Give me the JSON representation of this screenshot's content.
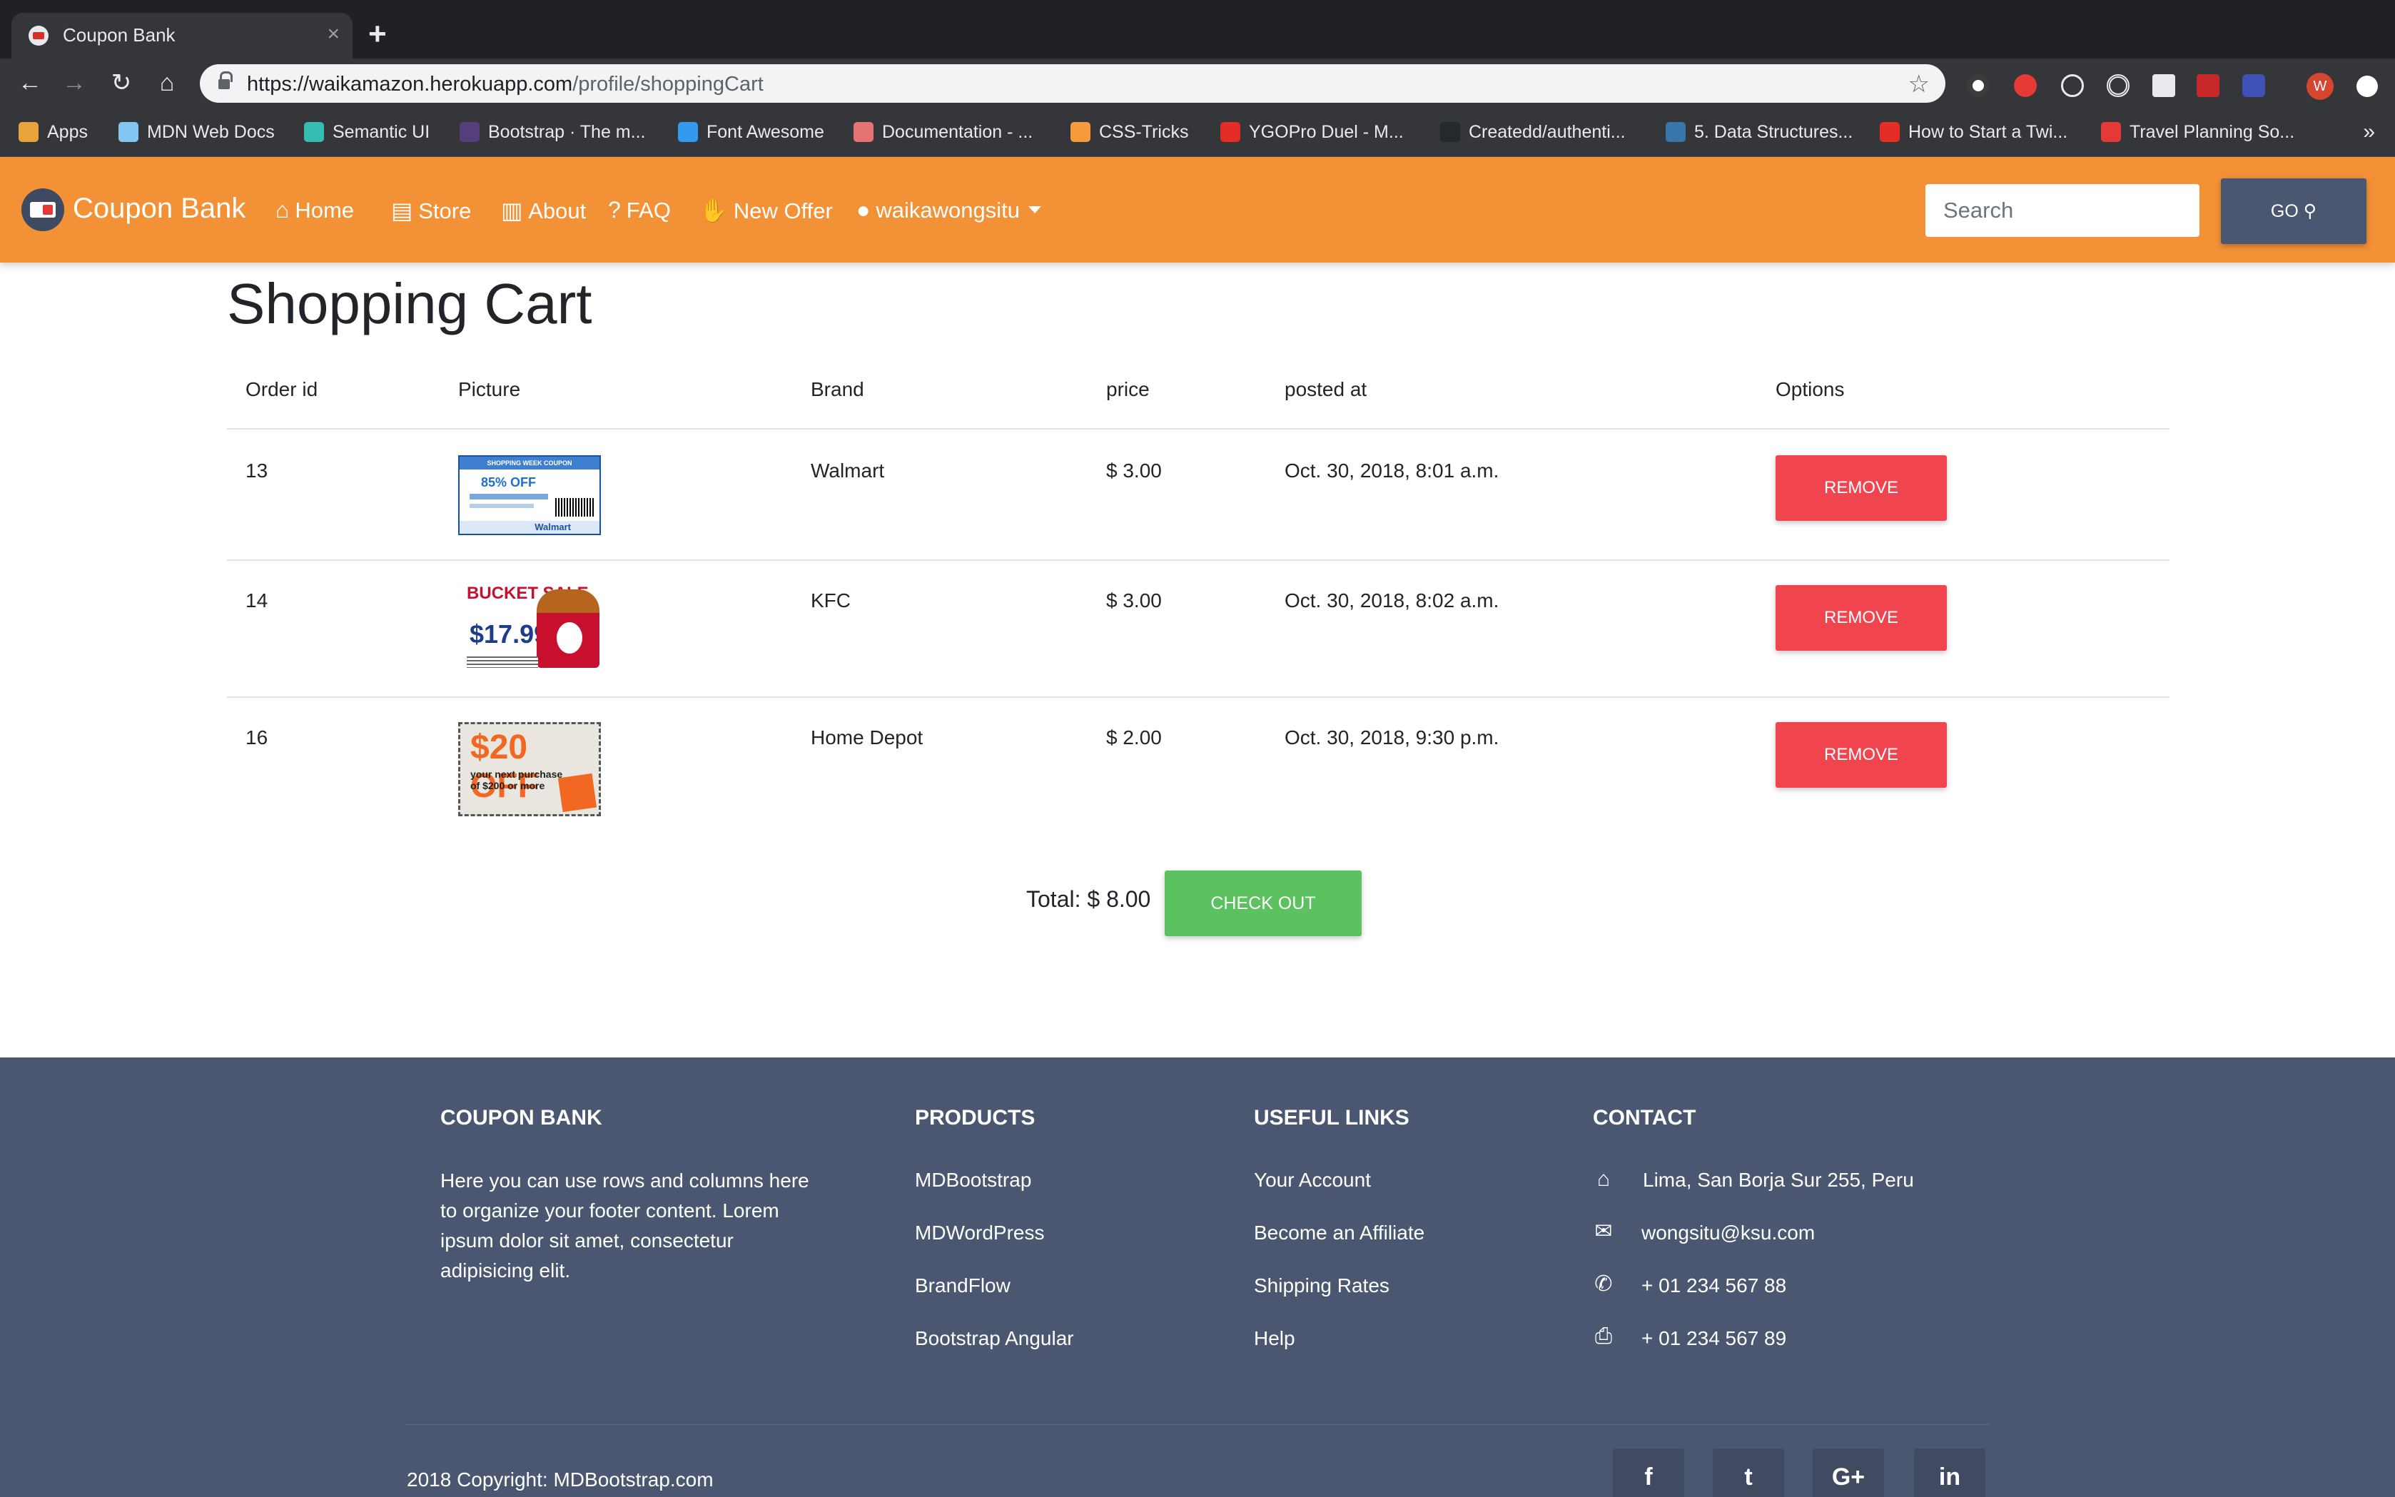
{
  "browser": {
    "tab_title": "Coupon Bank",
    "tab_close": "×",
    "new_tab": "+",
    "url_host": "https://waikamazon.herokuapp.com",
    "url_path": "/profile/shoppingCart",
    "avatar_letter": "W",
    "bookmarks": [
      {
        "label": "Apps",
        "icon": "apps-grid-icon",
        "color": "#e8a33d"
      },
      {
        "label": "MDN Web Docs",
        "icon": "mdn-icon",
        "color": "#83c6f2"
      },
      {
        "label": "Semantic UI",
        "icon": "semantic-ui-icon",
        "color": "#35bdb2"
      },
      {
        "label": "Bootstrap · The m...",
        "icon": "bootstrap-icon",
        "color": "#563d7c"
      },
      {
        "label": "Font Awesome",
        "icon": "flag-icon",
        "color": "#339af0"
      },
      {
        "label": "Documentation - ...",
        "icon": "docs-icon",
        "color": "#e57373"
      },
      {
        "label": "CSS-Tricks",
        "icon": "css-tricks-icon",
        "color": "#f59b3d"
      },
      {
        "label": "YGOPro Duel - M...",
        "icon": "youtube-icon",
        "color": "#e52d27"
      },
      {
        "label": "Createdd/authenti...",
        "icon": "github-icon",
        "color": "#24292e"
      },
      {
        "label": "5. Data Structures...",
        "icon": "python-icon",
        "color": "#3776ab"
      },
      {
        "label": "How to Start a Twi...",
        "icon": "youtube-icon",
        "color": "#e52d27"
      },
      {
        "label": "Travel Planning So...",
        "icon": "crescent-icon",
        "color": "#e53935"
      }
    ],
    "bookmarks_more": "»"
  },
  "navbar": {
    "brand": "Coupon Bank",
    "items": [
      {
        "label": "Home",
        "icon": "home-icon",
        "glyph": "⌂"
      },
      {
        "label": "Store",
        "icon": "store-icon",
        "glyph": "▤"
      },
      {
        "label": "About",
        "icon": "building-icon",
        "glyph": "▥"
      },
      {
        "label": "FAQ",
        "icon": "question-circle-icon",
        "glyph": "?"
      },
      {
        "label": "New Offer",
        "icon": "hand-offer-icon",
        "glyph": "✋"
      },
      {
        "label": "waikawongsitu",
        "icon": "user-icon",
        "glyph": "●"
      }
    ],
    "search_placeholder": "Search",
    "go_label": "GO"
  },
  "cart": {
    "title": "Shopping Cart",
    "headers": [
      "Order id",
      "Picture",
      "Brand",
      "price",
      "posted at",
      "Options"
    ],
    "rows": [
      {
        "id": "13",
        "brand": "Walmart",
        "price": "$ 3.00",
        "posted": "Oct. 30, 2018, 8:01 a.m.",
        "remove": "REMOVE"
      },
      {
        "id": "14",
        "brand": "KFC",
        "price": "$ 3.00",
        "posted": "Oct. 30, 2018, 8:02 a.m.",
        "remove": "REMOVE"
      },
      {
        "id": "16",
        "brand": "Home Depot",
        "price": "$ 2.00",
        "posted": "Oct. 30, 2018, 9:30 p.m.",
        "remove": "REMOVE"
      }
    ],
    "coupons": {
      "walmart": {
        "header": "SHOPPING WEEK COUPON",
        "offer": "85% OFF",
        "footer": "Walmart"
      },
      "kfc": {
        "headline": "BUCKET SALE",
        "price": "$17.99"
      },
      "homedepot": {
        "offer": "$20 OFF",
        "text": "your next purchase of $200 or more"
      }
    },
    "total_label": "Total:",
    "total_value": "$ 8.00",
    "checkout": "CHECK OUT"
  },
  "footer": {
    "about": {
      "heading": "COUPON BANK",
      "text": "Here you can use rows and columns here to organize your footer content. Lorem ipsum dolor sit amet, consectetur adipisicing elit."
    },
    "products": {
      "heading": "PRODUCTS",
      "links": [
        "MDBootstrap",
        "MDWordPress",
        "BrandFlow",
        "Bootstrap Angular"
      ]
    },
    "useful": {
      "heading": "USEFUL LINKS",
      "links": [
        "Your Account",
        "Become an Affiliate",
        "Shipping Rates",
        "Help"
      ]
    },
    "contact": {
      "heading": "CONTACT",
      "items": [
        {
          "text": "Lima, San Borja Sur 255, Peru",
          "icon": "home-icon"
        },
        {
          "text": "wongsitu@ksu.com",
          "icon": "envelope-icon"
        },
        {
          "text": "+ 01 234 567 88",
          "icon": "phone-icon"
        },
        {
          "text": "+ 01 234 567 89",
          "icon": "print-icon"
        }
      ]
    },
    "copyright_prefix": "2018 Copyright:",
    "copyright_link": "MDBootstrap.com",
    "social": [
      {
        "icon": "facebook-icon",
        "glyph": "f"
      },
      {
        "icon": "twitter-icon",
        "glyph": "t"
      },
      {
        "icon": "google-plus-icon",
        "glyph": "G+"
      },
      {
        "icon": "linkedin-icon",
        "glyph": "in"
      }
    ]
  }
}
